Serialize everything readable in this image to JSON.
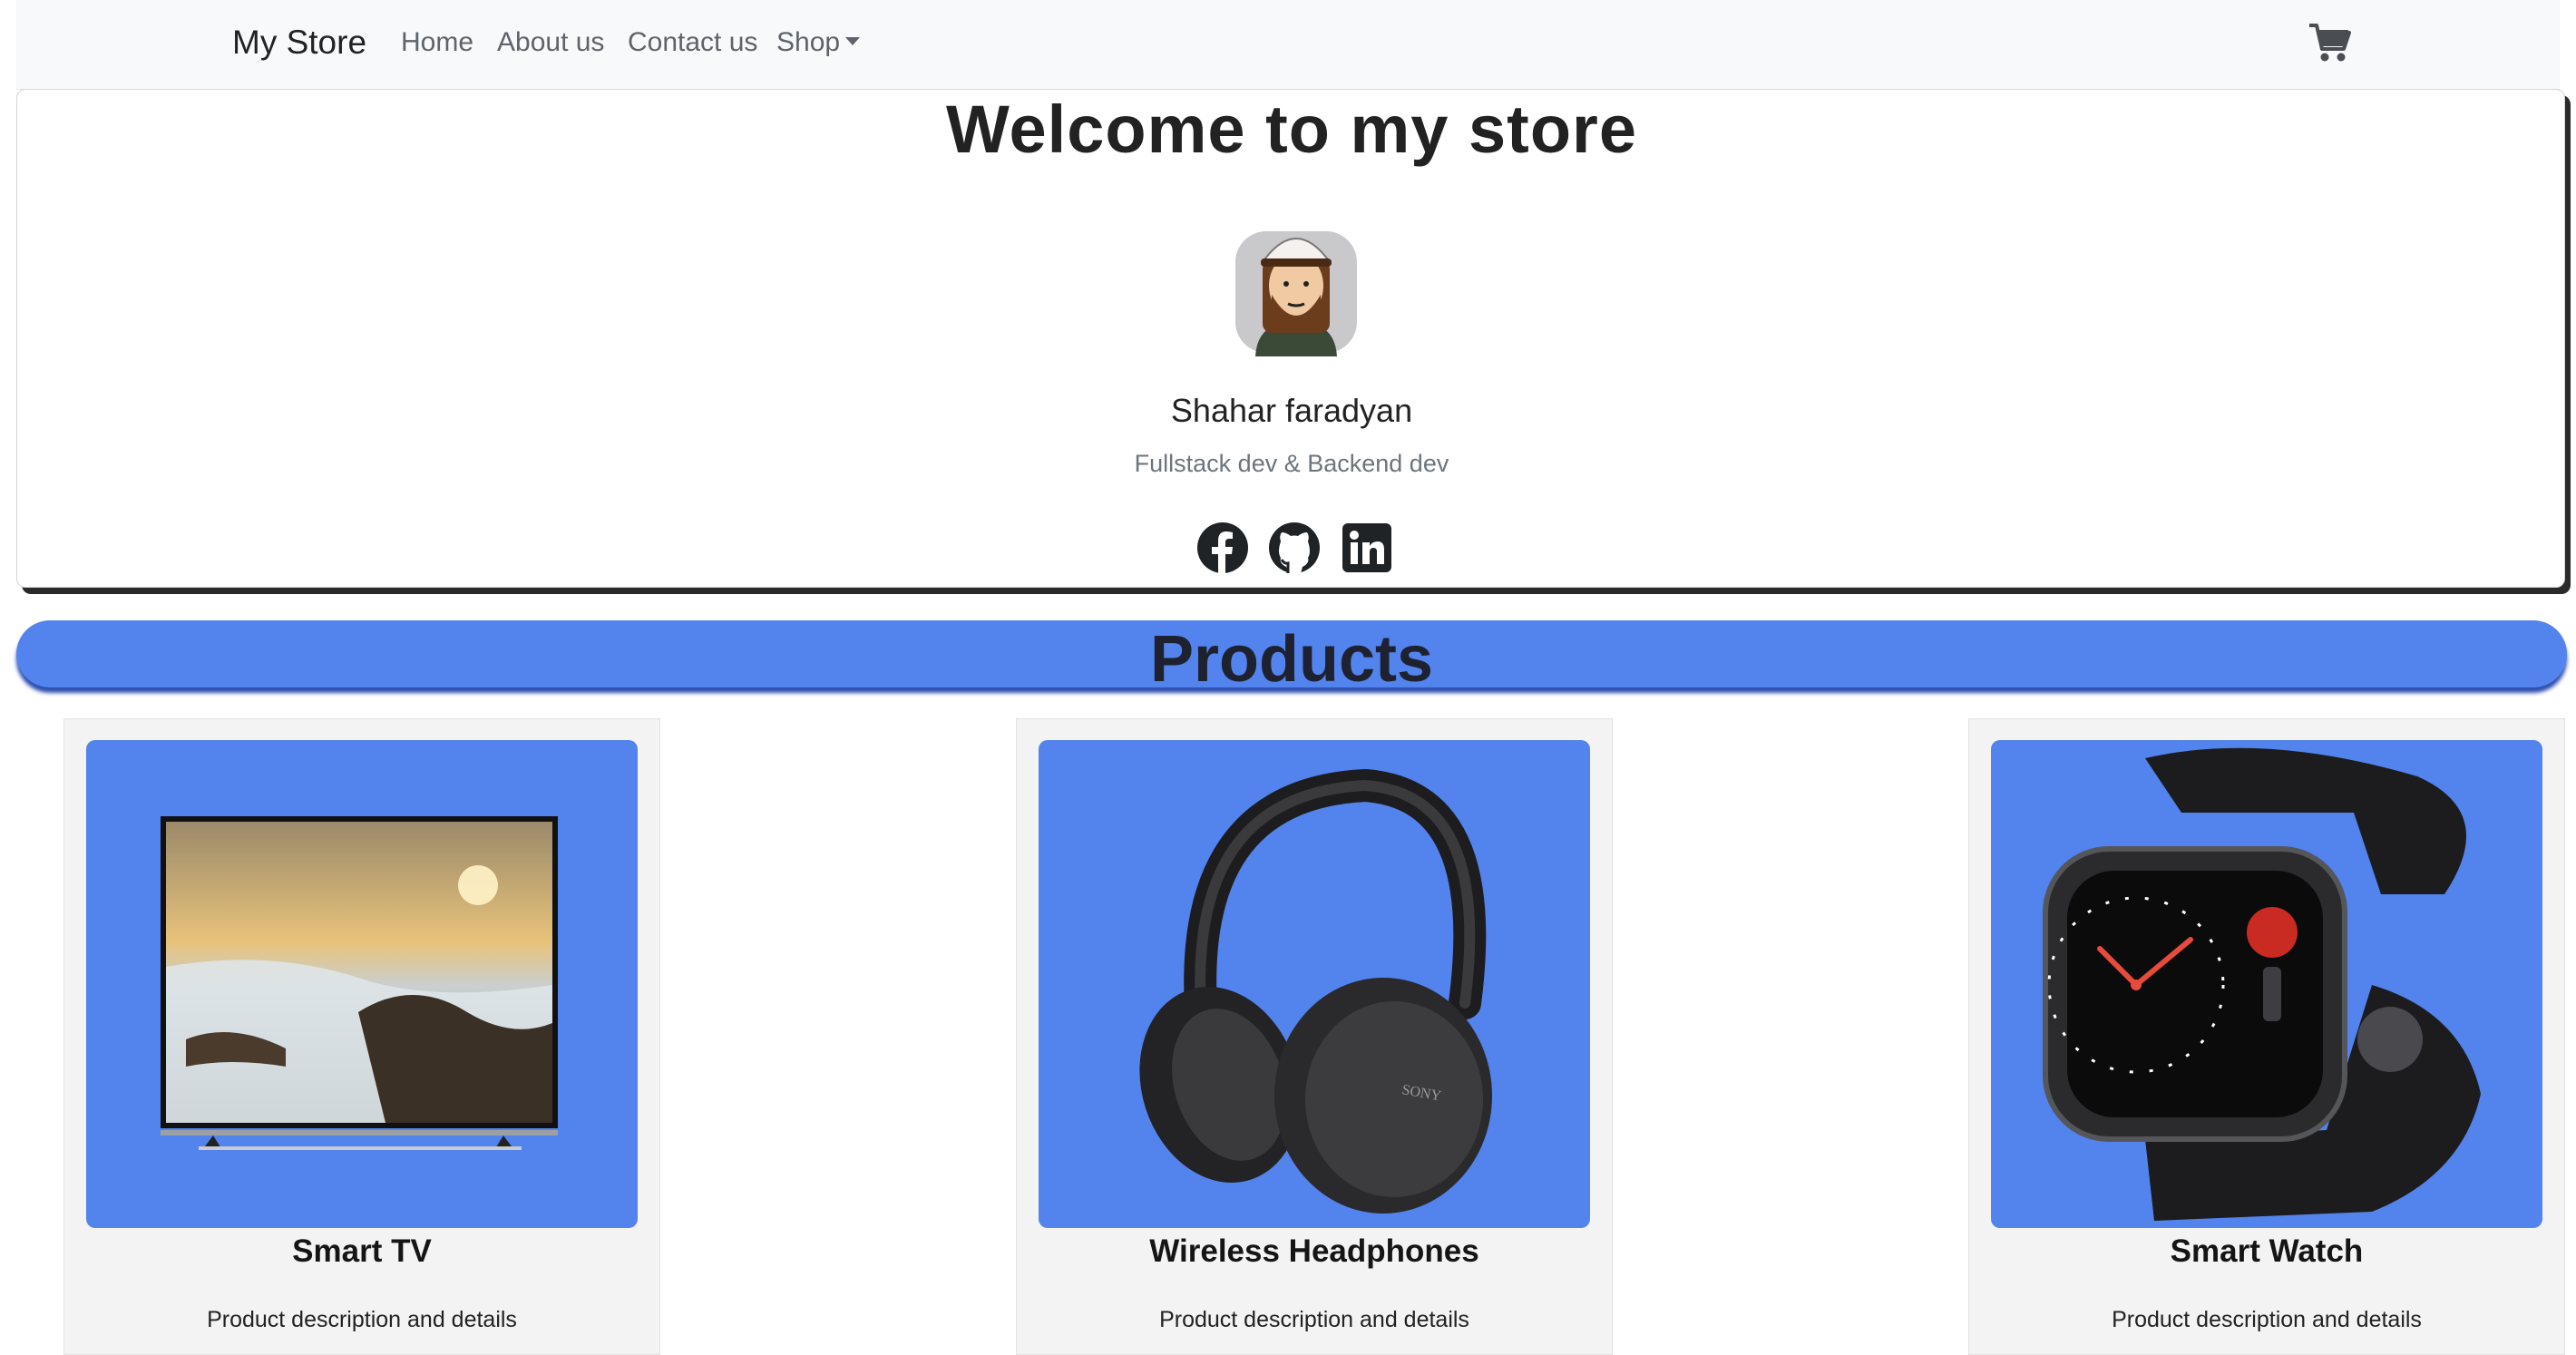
{
  "navbar": {
    "brand": "My Store",
    "links": [
      "Home",
      "About us",
      "Contact us"
    ],
    "shop_label": "Shop",
    "cart_icon": "cart-icon"
  },
  "profile": {
    "heading": "Welcome to my store",
    "name": "Shahar faradyan",
    "role": "Fullstack dev & Backend dev",
    "socials": [
      "facebook-icon",
      "github-icon",
      "linkedin-icon"
    ]
  },
  "products_heading": "Products",
  "products": [
    {
      "title": "Smart TV",
      "description": "Product description and details"
    },
    {
      "title": "Wireless Headphones",
      "description": "Product description and details"
    },
    {
      "title": "Smart Watch",
      "description": "Product description and details"
    }
  ],
  "colors": {
    "accent": "#5383ec",
    "navbar_bg": "#f8f9fa",
    "card_bg": "#f3f3f3"
  }
}
